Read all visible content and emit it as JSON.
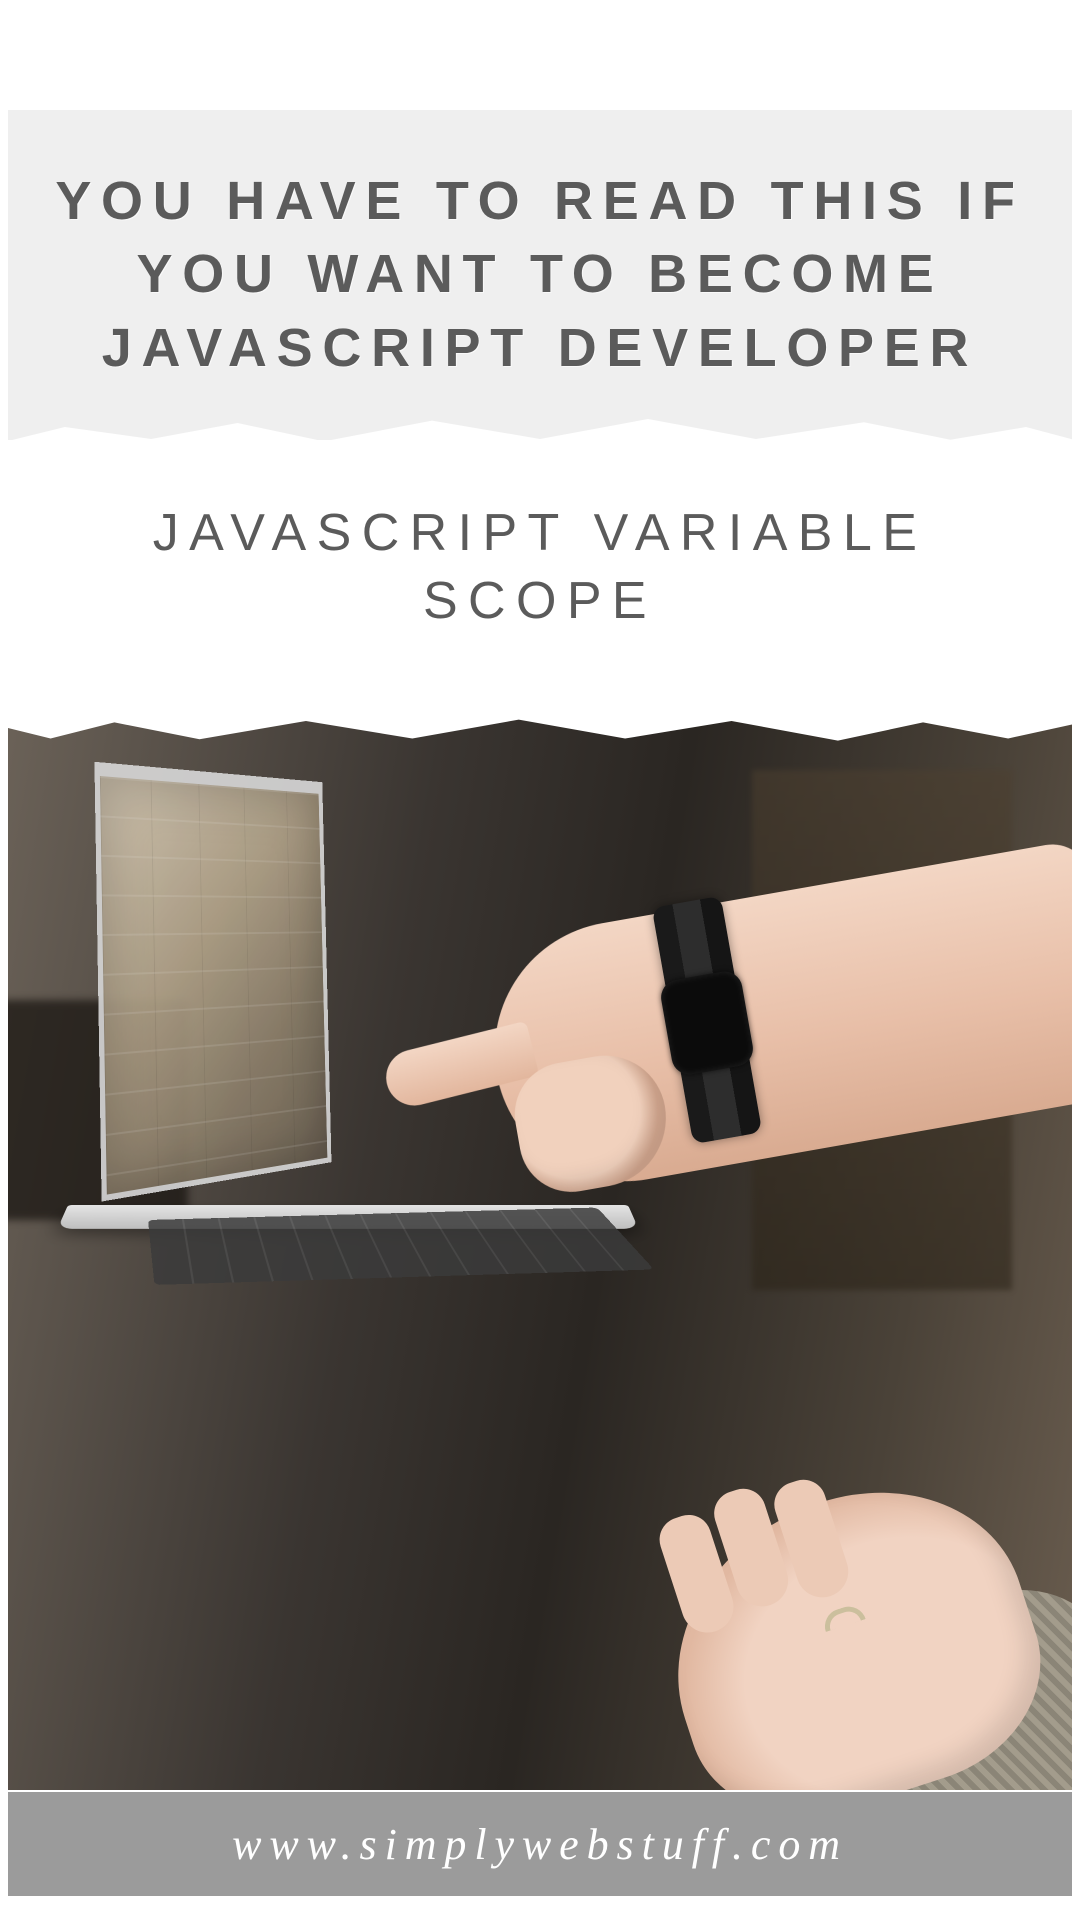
{
  "hero": {
    "title": "YOU HAVE TO READ THIS IF YOU WANT TO BECOME JAVASCRIPT DEVELOPER"
  },
  "subtitle": {
    "text": "JAVASCRIPT VARIABLE SCOPE"
  },
  "footer": {
    "url": "www.simplywebstuff.com"
  },
  "image": {
    "description": "photo-laptop-pointing-hand"
  }
}
